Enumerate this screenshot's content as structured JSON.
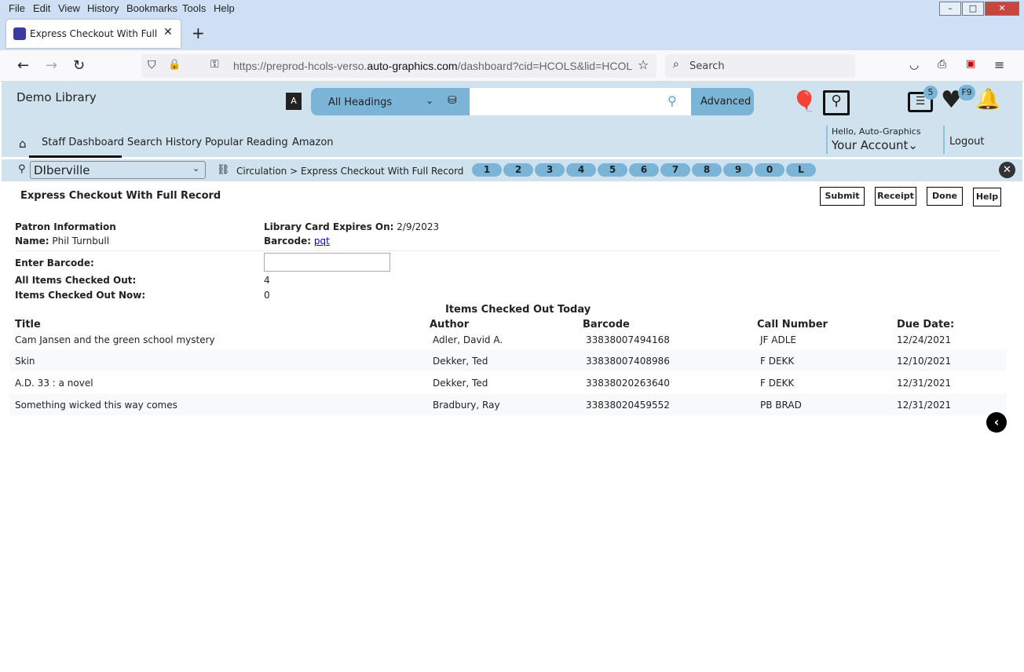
{
  "menu": [
    "File",
    "Edit",
    "View",
    "History",
    "Bookmarks",
    "Tools",
    "Help"
  ],
  "browser": {
    "tab_title": "Express Checkout With Full Rec",
    "url_prefix": "https://preprod-hcols-verso.",
    "url_domain": "auto-graphics.com",
    "url_rest": "/dashboard?cid=HCOLS&lid=HCOL",
    "search_placeholder": "Search"
  },
  "header": {
    "library": "Demo Library",
    "heading_select": "All Headings",
    "advanced": "Advanced",
    "list_badge": "5",
    "heart_badge": "F9",
    "greeting": "Hello, Auto-Graphics",
    "account": "Your Account",
    "logout": "Logout"
  },
  "nav": [
    "Staff Dashboard",
    "Search History",
    "Popular Reading",
    "Amazon"
  ],
  "location": {
    "branch": "DIberville",
    "breadcrumb": "Circulation > Express Checkout With Full Record",
    "pills": [
      "1",
      "2",
      "3",
      "4",
      "5",
      "6",
      "7",
      "8",
      "9",
      "0",
      "L"
    ]
  },
  "page": {
    "title": "Express Checkout With Full Record",
    "buttons": [
      "Submit",
      "Receipt",
      "Done",
      "Help"
    ]
  },
  "patron": {
    "section": "Patron Information",
    "name_label": "Name:",
    "name": "Phil Turnbull",
    "expires_label": "Library Card Expires On:",
    "expires": "2/9/2023",
    "barcode_label": "Barcode:",
    "barcode": "pqt",
    "enter_barcode_label": "Enter Barcode:",
    "enter_barcode_value": "",
    "all_label": "All Items Checked Out:",
    "all": "4",
    "now_label": "Items Checked Out Now:",
    "now": "0"
  },
  "table": {
    "caption": "Items Checked Out Today",
    "headers": [
      "Title",
      "Author",
      "Barcode",
      "Call Number",
      "Due Date:"
    ],
    "rows": [
      [
        "Cam Jansen and the green school mystery",
        "Adler, David A.",
        "33838007494168",
        "JF ADLE",
        "12/24/2021"
      ],
      [
        "Skin",
        "Dekker, Ted",
        "33838007408986",
        "F DEKK",
        "12/10/2021"
      ],
      [
        "A.D. 33 : a novel",
        "Dekker, Ted",
        "33838020263640",
        "F DEKK",
        "12/31/2021"
      ],
      [
        "Something wicked this way comes",
        "Bradbury, Ray",
        "33838020459552",
        "PB BRAD",
        "12/31/2021"
      ]
    ]
  }
}
